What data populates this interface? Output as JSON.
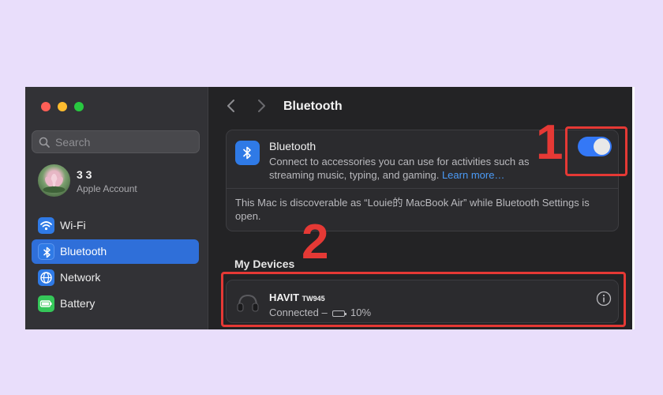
{
  "window": {
    "traffic_lights": {
      "close": "#fe5f57",
      "minimize": "#febc2e",
      "maximize": "#28c840"
    }
  },
  "sidebar": {
    "search_placeholder": "Search",
    "account": {
      "name": "3 3",
      "subtitle": "Apple Account"
    },
    "items": [
      {
        "label": "Wi-Fi",
        "icon": "wifi-icon",
        "color": "#2f7ae6",
        "active": false
      },
      {
        "label": "Bluetooth",
        "icon": "bluetooth-icon",
        "color": "#2f7ae6",
        "active": true
      },
      {
        "label": "Network",
        "icon": "globe-icon",
        "color": "#2f7ae6",
        "active": false
      },
      {
        "label": "Battery",
        "icon": "battery-icon",
        "color": "#35c759",
        "active": false
      }
    ]
  },
  "main": {
    "title": "Bluetooth",
    "bluetooth_card": {
      "title": "Bluetooth",
      "description": "Connect to accessories you can use for activities such as streaming music, typing, and gaming.",
      "link": "Learn more…",
      "toggle_on": true,
      "discoverable_note": "This Mac is discoverable as “Louie的 MacBook Air” while Bluetooth Settings is open."
    },
    "my_devices": {
      "title": "My Devices",
      "devices": [
        {
          "name": "HAVIT",
          "model": "TW945",
          "status": "Connected –",
          "battery": "10%",
          "icon": "headphones-icon"
        }
      ]
    }
  },
  "annotations": [
    {
      "number": "1",
      "color": "#e53935"
    },
    {
      "number": "2",
      "color": "#e53935"
    }
  ]
}
